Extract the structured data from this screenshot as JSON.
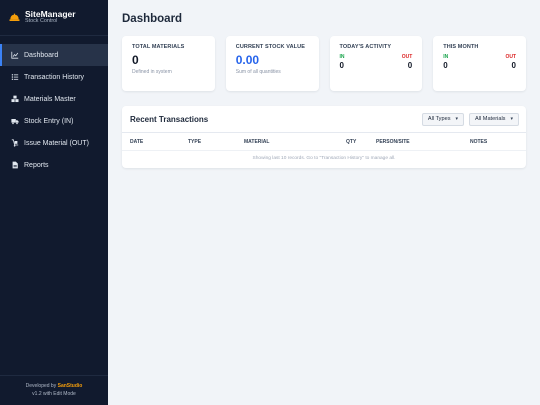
{
  "brand": {
    "title": "SiteManager",
    "subtitle": "Stock Control"
  },
  "nav": [
    {
      "label": "Dashboard",
      "icon": "chart-line-icon",
      "active": true
    },
    {
      "label": "Transaction History",
      "icon": "list-icon",
      "active": false
    },
    {
      "label": "Materials Master",
      "icon": "cubes-icon",
      "active": false
    },
    {
      "label": "Stock Entry (IN)",
      "icon": "truck-icon",
      "active": false
    },
    {
      "label": "Issue Material (OUT)",
      "icon": "dolly-icon",
      "active": false
    },
    {
      "label": "Reports",
      "icon": "file-icon",
      "active": false
    }
  ],
  "footer": {
    "dev_prefix": "Developed by",
    "dev_brand": "SanStudio",
    "version": "v1.2 with Edit Mode"
  },
  "page": {
    "title": "Dashboard"
  },
  "cards": {
    "total_materials": {
      "label": "TOTAL MATERIALS",
      "value": "0",
      "hint": "Defined in system"
    },
    "stock_value": {
      "label": "CURRENT STOCK VALUE",
      "value": "0.00",
      "hint": "Sum of all quantities"
    },
    "today": {
      "label": "TODAY'S ACTIVITY",
      "in_label": "IN",
      "in_value": "0",
      "out_label": "OUT",
      "out_value": "0"
    },
    "month": {
      "label": "THIS MONTH",
      "in_label": "IN",
      "in_value": "0",
      "out_label": "OUT",
      "out_value": "0"
    }
  },
  "recent": {
    "title": "Recent Transactions",
    "type_filter": "All Types",
    "material_filter": "All Materials",
    "columns": [
      "DATE",
      "TYPE",
      "MATERIAL",
      "QTY",
      "PERSON/SITE",
      "NOTES"
    ],
    "empty_note": "Showing last 10 records. Go to \"Transaction History\" to manage all."
  },
  "colors": {
    "sidebar_bg": "#111a2e",
    "accent": "#3b82f6",
    "brand_orange": "#f59e0b",
    "in_green": "#16a34a",
    "out_red": "#dc2626",
    "value_blue": "#2563eb"
  }
}
